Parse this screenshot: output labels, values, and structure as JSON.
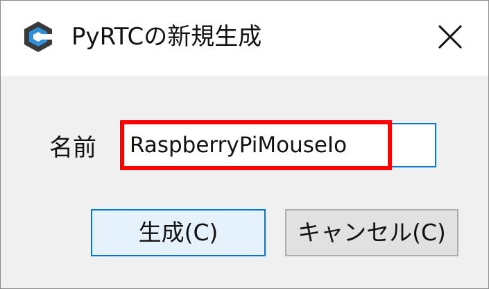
{
  "window": {
    "title": "PyRTCの新規生成",
    "app_icon": "pyrtc-logo-icon",
    "close_icon": "close-icon"
  },
  "form": {
    "name_label": "名前",
    "name_value": "RaspberryPiMouseIo"
  },
  "buttons": {
    "create_label": "生成(C)",
    "cancel_label": "キャンセル(C)"
  },
  "colors": {
    "accent": "#0078d7",
    "highlight": "#ff0000",
    "logo_dark": "#3a3a3a",
    "logo_blue": "#2f8fd8"
  }
}
